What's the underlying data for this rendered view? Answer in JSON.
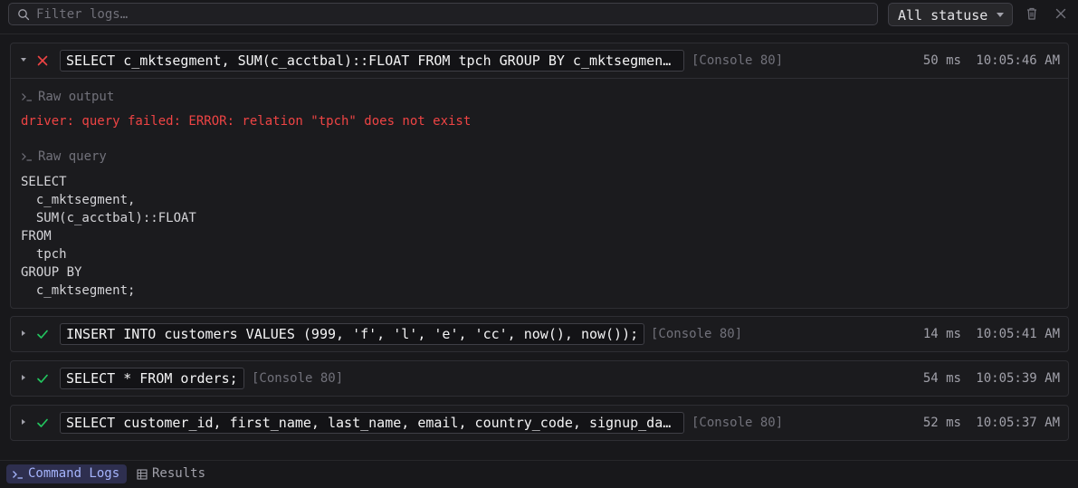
{
  "filter": {
    "placeholder": "Filter logs…",
    "value": ""
  },
  "status_filter": {
    "selected": "All statuse"
  },
  "icons": {
    "search": "search-icon",
    "trash": "trash-icon",
    "close": "close-icon"
  },
  "colors": {
    "error": "#ef4444",
    "success": "#22c55e",
    "accent": "#a5b4fc"
  },
  "logs": [
    {
      "status": "error",
      "expanded": true,
      "query": "SELECT c_mktsegment, SUM(c_acctbal)::FLOAT FROM tpch GROUP BY c_mktsegment;",
      "console": "[Console 80]",
      "duration": "50 ms",
      "time": "10:05:46 AM",
      "raw_output_label": "Raw output",
      "raw_output": "driver: query failed: ERROR: relation \"tpch\" does not exist",
      "raw_query_label": "Raw query",
      "raw_query": "SELECT\n  c_mktsegment,\n  SUM(c_acctbal)::FLOAT\nFROM\n  tpch\nGROUP BY\n  c_mktsegment;"
    },
    {
      "status": "success",
      "expanded": false,
      "query": "INSERT INTO customers VALUES (999, 'f', 'l', 'e', 'cc', now(), now());",
      "console": "[Console 80]",
      "duration": "14 ms",
      "time": "10:05:41 AM"
    },
    {
      "status": "success",
      "expanded": false,
      "query": "SELECT * FROM orders;",
      "console": "[Console 80]",
      "duration": "54 ms",
      "time": "10:05:39 AM"
    },
    {
      "status": "success",
      "expanded": false,
      "query": "SELECT customer_id, first_name, last_name, email, country_code, signup_dat…",
      "console": "[Console 80]",
      "duration": "52 ms",
      "time": "10:05:37 AM"
    }
  ],
  "bottom_tabs": [
    {
      "label": "Command Logs",
      "active": true
    },
    {
      "label": "Results",
      "active": false
    }
  ]
}
